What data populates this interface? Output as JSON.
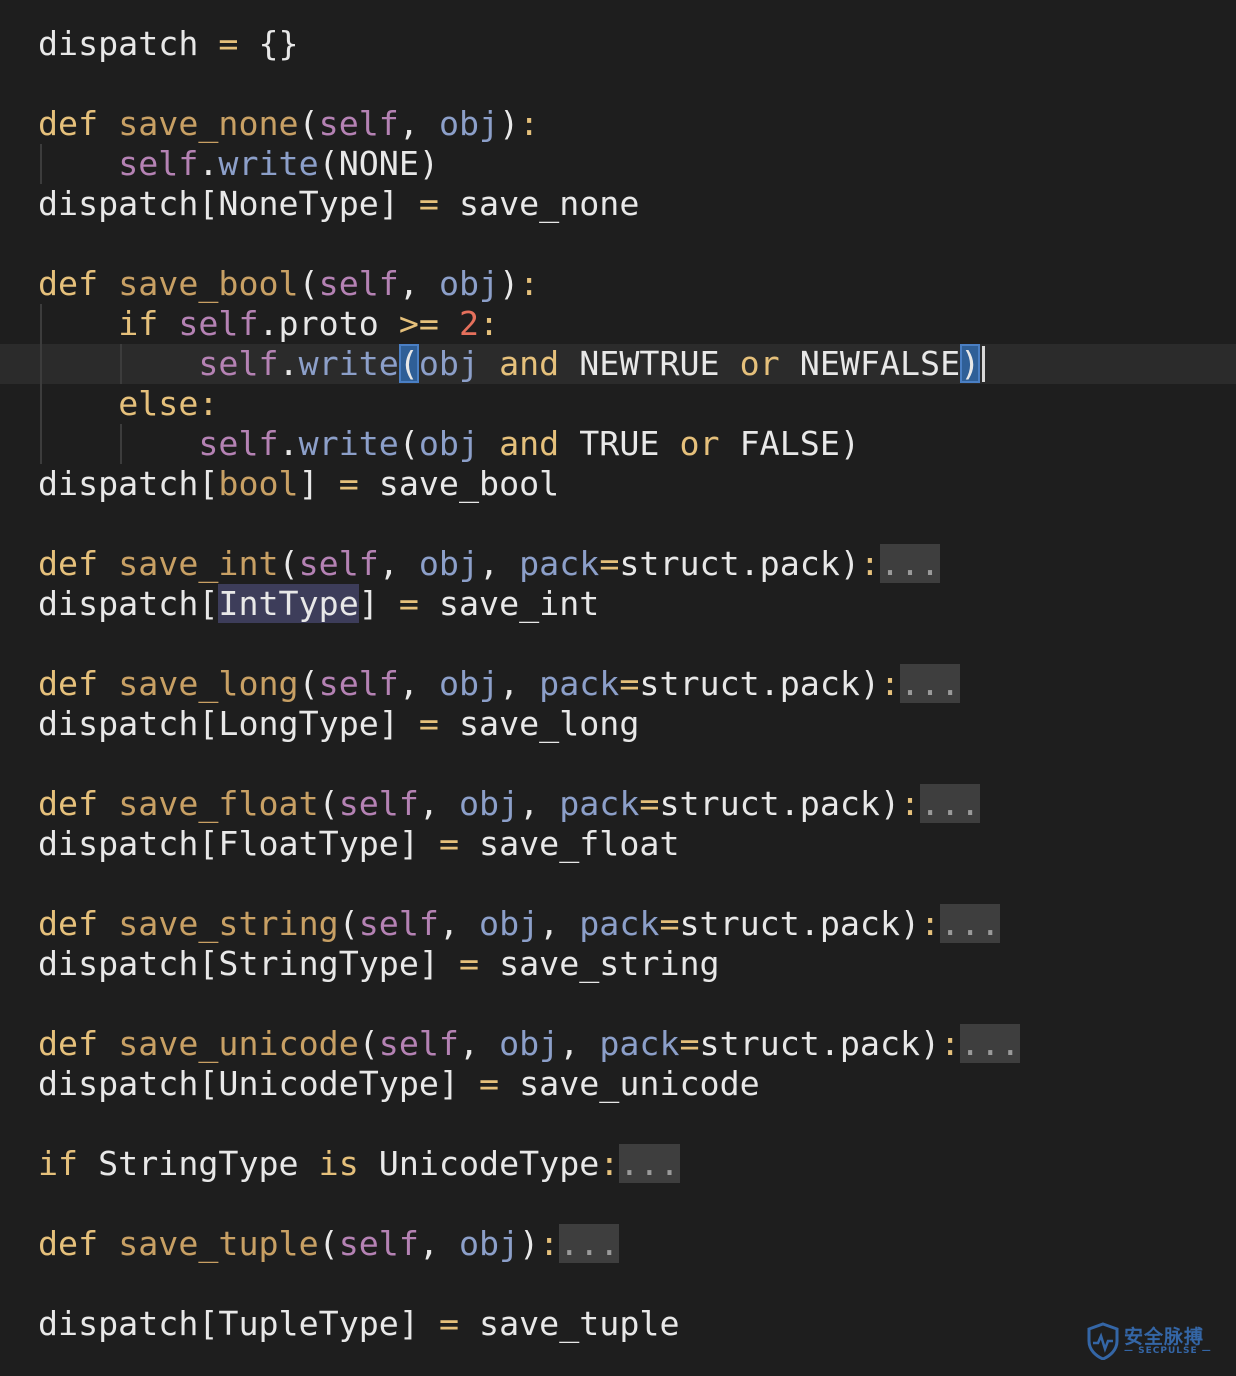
{
  "editor": {
    "lines": [
      [
        [
          "plain",
          "dispatch "
        ],
        [
          "op",
          "="
        ],
        [
          "plain",
          " {}"
        ]
      ],
      [],
      [
        [
          "kw",
          "def"
        ],
        [
          "plain",
          " "
        ],
        [
          "fn",
          "save_none"
        ],
        [
          "plain",
          "("
        ],
        [
          "self",
          "self"
        ],
        [
          "plain",
          ", "
        ],
        [
          "param",
          "obj"
        ],
        [
          "plain",
          ")"
        ],
        [
          "op",
          ":"
        ]
      ],
      [
        [
          "plain",
          "    "
        ],
        [
          "self",
          "self"
        ],
        [
          "plain",
          "."
        ],
        [
          "method",
          "write"
        ],
        [
          "plain",
          "(NONE)"
        ]
      ],
      [
        [
          "plain",
          "dispatch[NoneType] "
        ],
        [
          "op",
          "="
        ],
        [
          "plain",
          " save_none"
        ]
      ],
      [],
      [
        [
          "kw",
          "def"
        ],
        [
          "plain",
          " "
        ],
        [
          "fn",
          "save_bool"
        ],
        [
          "plain",
          "("
        ],
        [
          "self",
          "self"
        ],
        [
          "plain",
          ", "
        ],
        [
          "param",
          "obj"
        ],
        [
          "plain",
          ")"
        ],
        [
          "op",
          ":"
        ]
      ],
      [
        [
          "plain",
          "    "
        ],
        [
          "kw",
          "if"
        ],
        [
          "plain",
          " "
        ],
        [
          "self",
          "self"
        ],
        [
          "plain",
          ".proto "
        ],
        [
          "op",
          ">="
        ],
        [
          "plain",
          " "
        ],
        [
          "num",
          "2"
        ],
        [
          "op",
          ":"
        ]
      ],
      [
        [
          "plain",
          "        "
        ],
        [
          "self",
          "self"
        ],
        [
          "plain",
          "."
        ],
        [
          "method",
          "write"
        ],
        [
          "match",
          "("
        ],
        [
          "param",
          "obj"
        ],
        [
          "plain",
          " "
        ],
        [
          "kw",
          "and"
        ],
        [
          "plain",
          " NEWTRUE "
        ],
        [
          "kw",
          "or"
        ],
        [
          "plain",
          " NEWFALSE"
        ],
        [
          "match",
          ")"
        ]
      ],
      [
        [
          "plain",
          "    "
        ],
        [
          "kw",
          "else"
        ],
        [
          "op",
          ":"
        ]
      ],
      [
        [
          "plain",
          "        "
        ],
        [
          "self",
          "self"
        ],
        [
          "plain",
          "."
        ],
        [
          "method",
          "write"
        ],
        [
          "plain",
          "("
        ],
        [
          "param",
          "obj"
        ],
        [
          "plain",
          " "
        ],
        [
          "kw",
          "and"
        ],
        [
          "plain",
          " TRUE "
        ],
        [
          "kw",
          "or"
        ],
        [
          "plain",
          " FALSE)"
        ]
      ],
      [
        [
          "plain",
          "dispatch["
        ],
        [
          "fn",
          "bool"
        ],
        [
          "plain",
          "] "
        ],
        [
          "op",
          "="
        ],
        [
          "plain",
          " save_bool"
        ]
      ],
      [],
      [
        [
          "kw",
          "def"
        ],
        [
          "plain",
          " "
        ],
        [
          "fn",
          "save_int"
        ],
        [
          "plain",
          "("
        ],
        [
          "self",
          "self"
        ],
        [
          "plain",
          ", "
        ],
        [
          "param",
          "obj"
        ],
        [
          "plain",
          ", "
        ],
        [
          "param",
          "pack"
        ],
        [
          "op",
          "="
        ],
        [
          "plain",
          "struct.pack)"
        ],
        [
          "op",
          ":"
        ],
        [
          "fold",
          "..."
        ]
      ],
      [
        [
          "plain",
          "dispatch["
        ],
        [
          "hl",
          "IntType"
        ],
        [
          "plain",
          "] "
        ],
        [
          "op",
          "="
        ],
        [
          "plain",
          " save_int"
        ]
      ],
      [],
      [
        [
          "kw",
          "def"
        ],
        [
          "plain",
          " "
        ],
        [
          "fn",
          "save_long"
        ],
        [
          "plain",
          "("
        ],
        [
          "self",
          "self"
        ],
        [
          "plain",
          ", "
        ],
        [
          "param",
          "obj"
        ],
        [
          "plain",
          ", "
        ],
        [
          "param",
          "pack"
        ],
        [
          "op",
          "="
        ],
        [
          "plain",
          "struct.pack)"
        ],
        [
          "op",
          ":"
        ],
        [
          "fold",
          "..."
        ]
      ],
      [
        [
          "plain",
          "dispatch[LongType] "
        ],
        [
          "op",
          "="
        ],
        [
          "plain",
          " save_long"
        ]
      ],
      [],
      [
        [
          "kw",
          "def"
        ],
        [
          "plain",
          " "
        ],
        [
          "fn",
          "save_float"
        ],
        [
          "plain",
          "("
        ],
        [
          "self",
          "self"
        ],
        [
          "plain",
          ", "
        ],
        [
          "param",
          "obj"
        ],
        [
          "plain",
          ", "
        ],
        [
          "param",
          "pack"
        ],
        [
          "op",
          "="
        ],
        [
          "plain",
          "struct.pack)"
        ],
        [
          "op",
          ":"
        ],
        [
          "fold",
          "..."
        ]
      ],
      [
        [
          "plain",
          "dispatch[FloatType] "
        ],
        [
          "op",
          "="
        ],
        [
          "plain",
          " save_float"
        ]
      ],
      [],
      [
        [
          "kw",
          "def"
        ],
        [
          "plain",
          " "
        ],
        [
          "fn",
          "save_string"
        ],
        [
          "plain",
          "("
        ],
        [
          "self",
          "self"
        ],
        [
          "plain",
          ", "
        ],
        [
          "param",
          "obj"
        ],
        [
          "plain",
          ", "
        ],
        [
          "param",
          "pack"
        ],
        [
          "op",
          "="
        ],
        [
          "plain",
          "struct.pack)"
        ],
        [
          "op",
          ":"
        ],
        [
          "fold",
          "..."
        ]
      ],
      [
        [
          "plain",
          "dispatch[StringType] "
        ],
        [
          "op",
          "="
        ],
        [
          "plain",
          " save_string"
        ]
      ],
      [],
      [
        [
          "kw",
          "def"
        ],
        [
          "plain",
          " "
        ],
        [
          "fn",
          "save_unicode"
        ],
        [
          "plain",
          "("
        ],
        [
          "self",
          "self"
        ],
        [
          "plain",
          ", "
        ],
        [
          "param",
          "obj"
        ],
        [
          "plain",
          ", "
        ],
        [
          "param",
          "pack"
        ],
        [
          "op",
          "="
        ],
        [
          "plain",
          "struct.pack)"
        ],
        [
          "op",
          ":"
        ],
        [
          "fold",
          "..."
        ]
      ],
      [
        [
          "plain",
          "dispatch[UnicodeType] "
        ],
        [
          "op",
          "="
        ],
        [
          "plain",
          " save_unicode"
        ]
      ],
      [],
      [
        [
          "kw",
          "if"
        ],
        [
          "plain",
          " StringType "
        ],
        [
          "kw",
          "is"
        ],
        [
          "plain",
          " UnicodeType"
        ],
        [
          "op",
          ":"
        ],
        [
          "fold",
          "..."
        ]
      ],
      [],
      [
        [
          "kw",
          "def"
        ],
        [
          "plain",
          " "
        ],
        [
          "fn",
          "save_tuple"
        ],
        [
          "plain",
          "("
        ],
        [
          "self",
          "self"
        ],
        [
          "plain",
          ", "
        ],
        [
          "param",
          "obj"
        ],
        [
          "plain",
          ")"
        ],
        [
          "op",
          ":"
        ],
        [
          "fold",
          "..."
        ]
      ],
      [],
      [
        [
          "plain",
          "dispatch[TupleType] "
        ],
        [
          "op",
          "="
        ],
        [
          "plain",
          " save_tuple"
        ]
      ]
    ],
    "current_line": 8
  },
  "watermark": {
    "text": "安全脉搏",
    "subtext": "— SECPULSE —"
  },
  "colors": {
    "background": "#1e1e1e",
    "keyword": "#e5c07b",
    "function": "#c8a064",
    "self": "#b582b4",
    "param": "#8c9fc9",
    "number": "#e5705c",
    "text": "#e8e8e8",
    "watermark": "#3a78c9"
  }
}
